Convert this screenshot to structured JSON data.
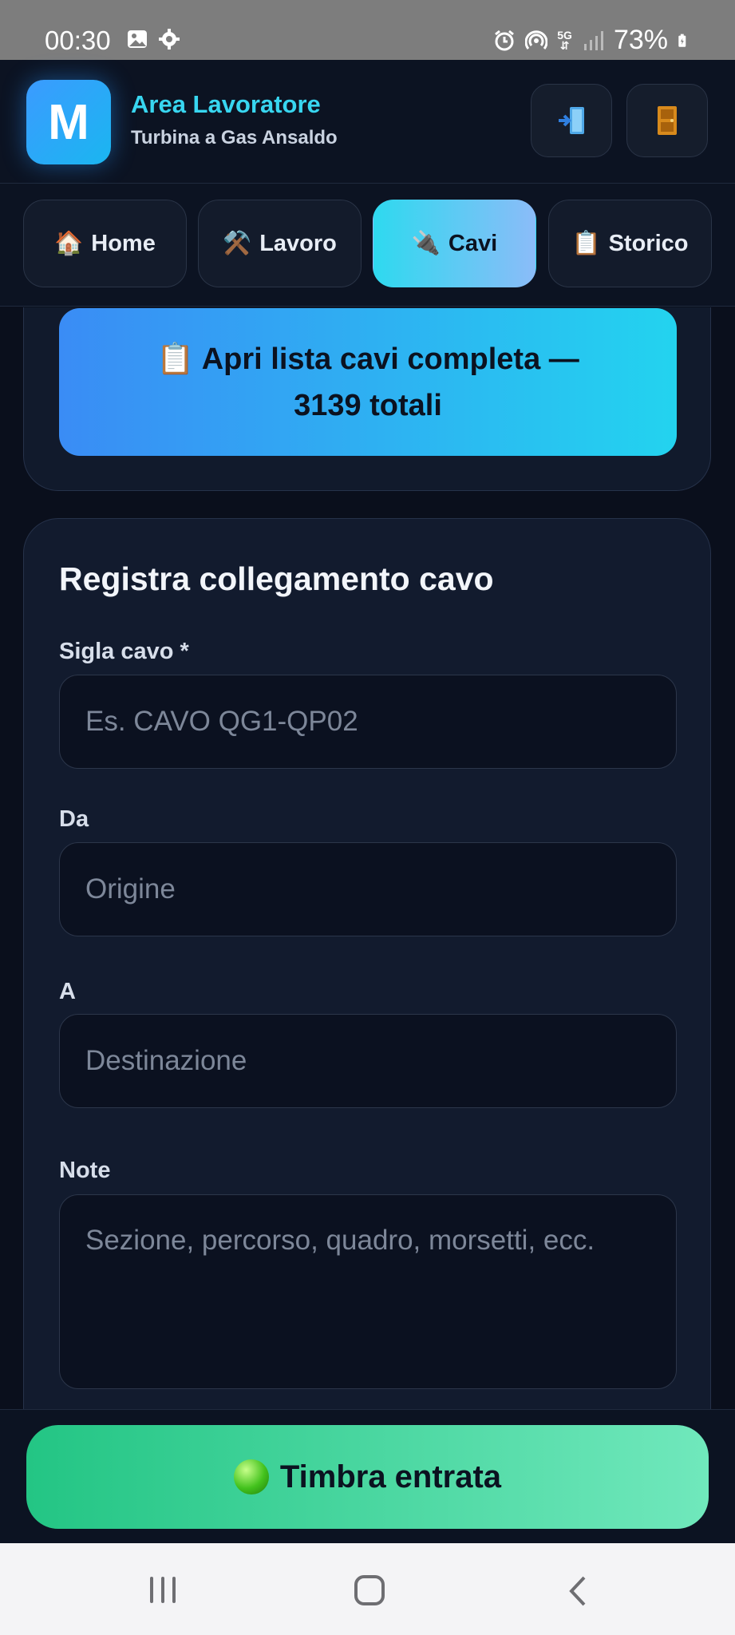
{
  "status_bar": {
    "time": "00:30",
    "network": "5G",
    "battery": "73%"
  },
  "header": {
    "logo_letter": "M",
    "title": "Area Lavoratore",
    "subtitle": "Turbina a Gas Ansaldo"
  },
  "tabs": [
    {
      "icon": "🏠",
      "label": "Home"
    },
    {
      "icon": "⚒️",
      "label": "Lavoro"
    },
    {
      "icon": "🔌",
      "label": "Cavi"
    },
    {
      "icon": "📋",
      "label": "Storico"
    }
  ],
  "cable_list": {
    "icon": "📋",
    "label": "Apri lista cavi completa — 3139 totali"
  },
  "form": {
    "title": "Registra collegamento cavo",
    "sigla_label": "Sigla cavo *",
    "sigla_placeholder": "Es. CAVO QG1-QP02",
    "da_label": "Da",
    "da_placeholder": "Origine",
    "a_label": "A",
    "a_placeholder": "Destinazione",
    "note_label": "Note",
    "note_placeholder": "Sezione, percorso, quadro, morsetti, ecc."
  },
  "punch_button": {
    "label": "Timbra entrata"
  }
}
